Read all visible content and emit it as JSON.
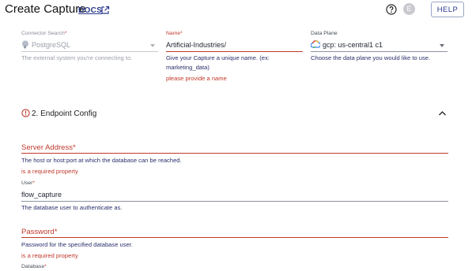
{
  "header": {
    "title": "Create Capture",
    "docs_label": "DOCS",
    "avatar_initial": "E",
    "help_label": "HELP"
  },
  "connector": {
    "label": "Connector Search",
    "required": "*",
    "value": "PostgreSQL",
    "helper": "The external system you're connecting to."
  },
  "name_field": {
    "label": "Name",
    "required": "*",
    "value": "Artificial-Industries/",
    "helper_line1": "Give your Capture a unique name. (ex:",
    "helper_line2": "marketing_data)",
    "error": "please provide a name"
  },
  "data_plane": {
    "label": "Data Plane",
    "value": "gcp: us-central1 c1",
    "helper": "Choose the data plane you would like to use."
  },
  "endpoint_section": {
    "title": "2. Endpoint Config"
  },
  "server_address": {
    "label": "Server Address",
    "required": "*",
    "helper": "The host or host:port at which the database can be reached.",
    "error": "is a required property"
  },
  "user": {
    "label": "User",
    "required": "*",
    "value": "flow_capture",
    "helper": "The database user to authenticate as."
  },
  "password": {
    "label": "Password",
    "required": "*",
    "helper": "Password for the specified database user.",
    "error": "is a required property"
  },
  "database": {
    "label": "Database",
    "required": "*"
  },
  "colors": {
    "error": "#c0392b",
    "link": "#2b3a8c",
    "helper": "#2a2f6b"
  }
}
